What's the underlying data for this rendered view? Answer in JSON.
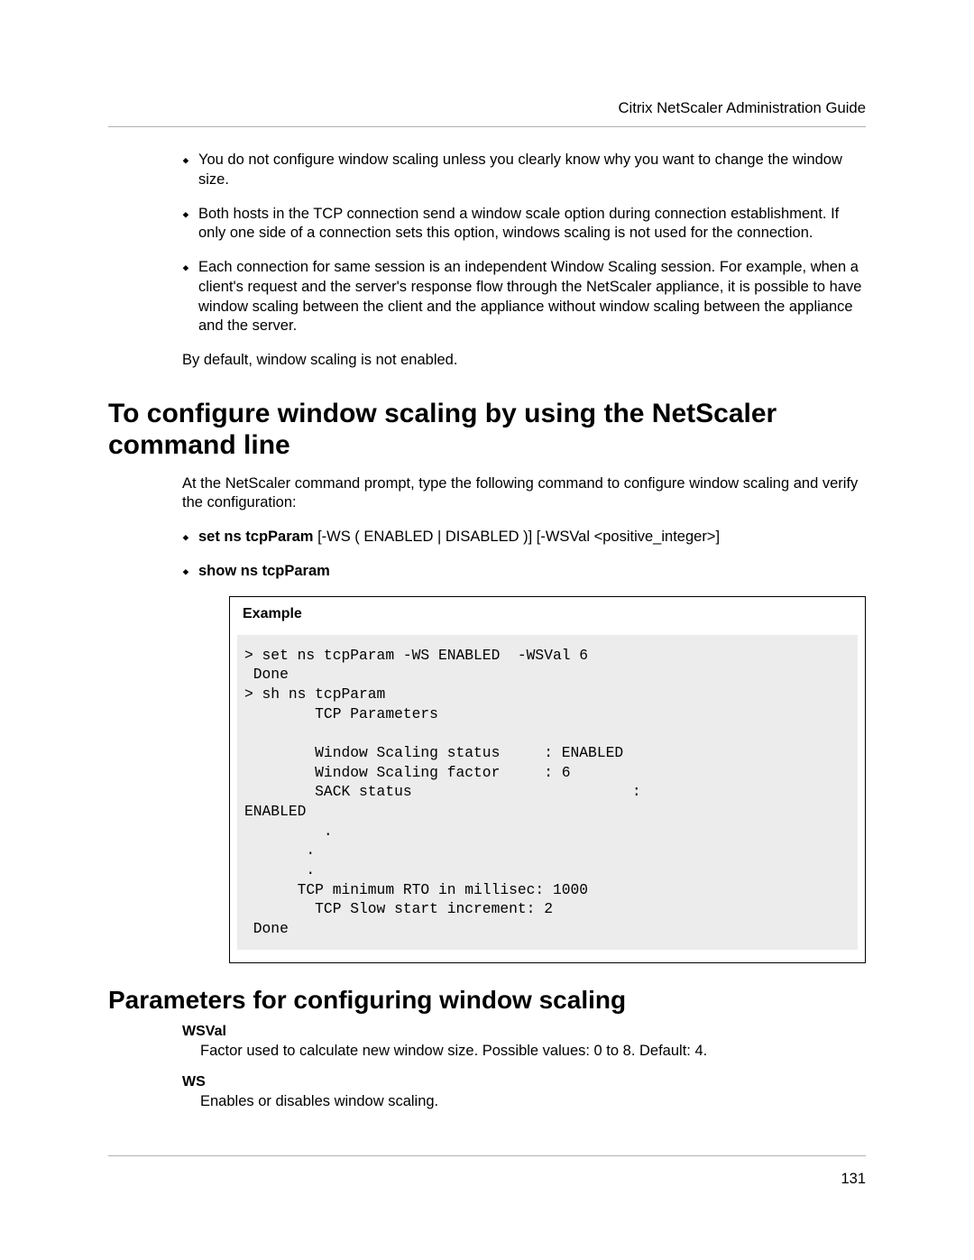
{
  "header": {
    "running_title": "Citrix NetScaler Administration Guide"
  },
  "intro": {
    "bullets": [
      "You do not configure window scaling unless you clearly know why you want to change the window size.",
      "Both hosts in the TCP connection send a window scale option during connection establishment. If only one side of a connection sets this option, windows scaling is not used for the connection.",
      "Each connection for same session is an independent Window Scaling session. For example, when a client's request and the server's response flow through the NetScaler appliance, it is possible to have window scaling between the client and the appliance without window scaling between the appliance and the server."
    ],
    "note": "By default, window scaling is not enabled."
  },
  "section_configure": {
    "heading": "To configure window scaling by using the NetScaler command line",
    "lead": "At the NetScaler command prompt, type the following command to configure window scaling and verify the configuration:",
    "commands": [
      {
        "bold": "set ns tcpParam",
        "rest": " [-WS ( ENABLED | DISABLED )] [-WSVal <positive_integer>]"
      },
      {
        "bold": "show ns tcpParam",
        "rest": ""
      }
    ],
    "example_label": "Example",
    "example_code": "> set ns tcpParam -WS ENABLED  -WSVal 6\n Done\n> sh ns tcpParam\n        TCP Parameters\n\n        Window Scaling status     : ENABLED\n        Window Scaling factor     : 6\n        SACK status                         : \nENABLED\n         .\n       .\n       .\n      TCP minimum RTO in millisec: 1000\n        TCP Slow start increment: 2\n Done"
  },
  "section_params": {
    "heading": "Parameters for configuring window scaling",
    "items": [
      {
        "term": "WSVal",
        "desc": "Factor used to calculate new window size. Possible values: 0 to 8. Default: 4."
      },
      {
        "term": "WS",
        "desc": "Enables or disables window scaling."
      }
    ]
  },
  "footer": {
    "page_number": "131"
  }
}
